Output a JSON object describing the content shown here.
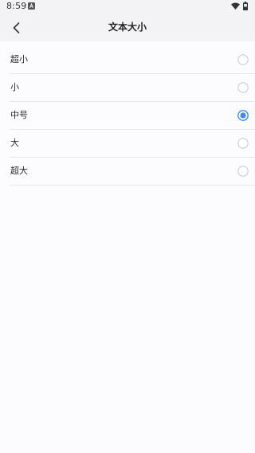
{
  "status_bar": {
    "time": "8:59"
  },
  "header": {
    "title": "文本大小"
  },
  "options": [
    {
      "label": "超小",
      "selected": false
    },
    {
      "label": "小",
      "selected": false
    },
    {
      "label": "中号",
      "selected": true
    },
    {
      "label": "大",
      "selected": false
    },
    {
      "label": "超大",
      "selected": false
    }
  ],
  "colors": {
    "accent": "#3d8bf0",
    "radio_unselected": "#c8c8cc",
    "header_bg": "#f3f3f6",
    "page_bg": "#fcfcfe"
  },
  "icons": {
    "back": "chevron-left-icon",
    "notification": "notification-a-icon",
    "wifi": "wifi-icon",
    "battery": "battery-icon"
  }
}
